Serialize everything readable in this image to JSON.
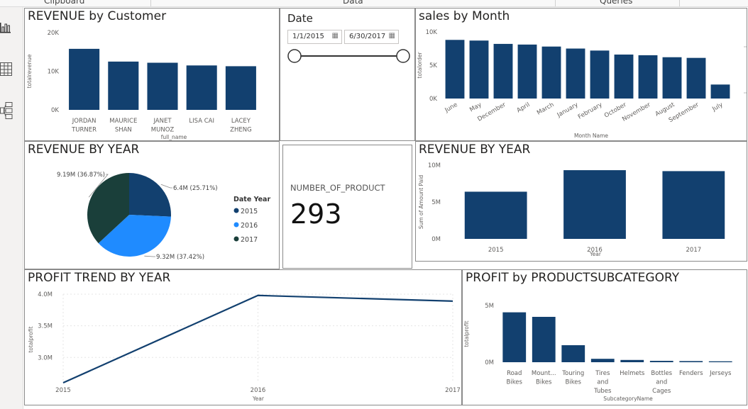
{
  "ribbon": {
    "tabs": [
      "Clipboard",
      "Data",
      "Queries"
    ]
  },
  "rail": {
    "icons": [
      "report-view-icon",
      "data-view-icon",
      "model-view-icon"
    ]
  },
  "colors": {
    "navy": "#12406f",
    "blue": "#1f8bff",
    "dark": "#1a3f3a",
    "grid": "#e5e5e5",
    "axis": "#605e5c"
  },
  "revenue_by_customer": {
    "title": "REVENUE by Customer",
    "chart_data": {
      "type": "bar",
      "categories": [
        [
          "JORDAN",
          "TURNER"
        ],
        [
          "MAURICE",
          "SHAN"
        ],
        [
          "JANET",
          "MUNOZ"
        ],
        [
          "LISA CAI"
        ],
        [
          "LACEY",
          "ZHENG"
        ]
      ],
      "values": [
        15800,
        12500,
        12200,
        11500,
        11300
      ],
      "ylabel": "totalrevenue",
      "xlabel": "full_name",
      "yticks": [
        "20K",
        "10K",
        "0K"
      ],
      "ylim": [
        0,
        20000
      ]
    }
  },
  "date_slicer": {
    "title": "Date",
    "start": "1/1/2015",
    "end": "6/30/2017"
  },
  "sales_by_month": {
    "title": "sales by Month",
    "chart_data": {
      "type": "bar",
      "categories": [
        "June",
        "May",
        "December",
        "April",
        "March",
        "January",
        "February",
        "October",
        "November",
        "August",
        "September",
        "July"
      ],
      "values": [
        8800,
        8700,
        8200,
        8100,
        7800,
        7500,
        7200,
        6600,
        6500,
        6200,
        6100,
        2100
      ],
      "ylabel": "totalorder",
      "xlabel": "Month Name",
      "yticks": [
        "10K",
        "5K",
        "0K"
      ],
      "ylim": [
        0,
        10000
      ]
    }
  },
  "revenue_by_year_pie": {
    "title": "REVENUE BY YEAR",
    "legend_title": "Date Year",
    "chart_data": {
      "type": "pie",
      "series": [
        {
          "name": "2015",
          "value": 6.4,
          "label": "6.4M (25.71%)",
          "color": "#12406f"
        },
        {
          "name": "2016",
          "value": 9.32,
          "label": "9.32M (37.42%)",
          "color": "#1f8bff"
        },
        {
          "name": "2017",
          "value": 9.19,
          "label": "9.19M (36.87%)",
          "color": "#1a3f3a"
        }
      ]
    }
  },
  "number_of_product": {
    "label": "NUMBER_OF_PRODUCT",
    "value": "293"
  },
  "revenue_by_year_bar": {
    "title": "REVENUE BY YEAR",
    "chart_data": {
      "type": "bar",
      "categories": [
        "2015",
        "2016",
        "2017"
      ],
      "values": [
        6.4,
        9.32,
        9.19
      ],
      "ylabel": "Sum of Amount Paid",
      "xlabel": "Year",
      "yticks": [
        "10M",
        "5M",
        "0M"
      ],
      "ylim": [
        0,
        10
      ]
    }
  },
  "profit_trend": {
    "title": "PROFIT TREND BY YEAR",
    "chart_data": {
      "type": "line",
      "x": [
        "2015",
        "2016",
        "2017"
      ],
      "values": [
        2.6,
        3.98,
        3.89
      ],
      "ylabel": "totalprofit",
      "xlabel": "Year",
      "yticks": [
        "4.0M",
        "3.5M",
        "3.0M"
      ],
      "ylim": [
        2.6,
        4.0
      ]
    }
  },
  "profit_by_subcategory": {
    "title": "PROFIT by PRODUCTSUBCATEGORY",
    "chart_data": {
      "type": "bar",
      "categories": [
        [
          "Road",
          "Bikes"
        ],
        [
          "Mount...",
          "Bikes"
        ],
        [
          "Touring",
          "Bikes"
        ],
        [
          "Tires",
          "and",
          "Tubes"
        ],
        [
          "Helmets"
        ],
        [
          "Bottles",
          "and",
          "Cages"
        ],
        [
          "Fenders"
        ],
        [
          "Jerseys"
        ]
      ],
      "values": [
        4.4,
        4.0,
        1.5,
        0.3,
        0.2,
        0.12,
        0.1,
        0.08
      ],
      "ylabel": "totalprofit",
      "xlabel": "SubcategoryName",
      "yticks": [
        "5M",
        "0M"
      ],
      "ylim": [
        0,
        5
      ]
    }
  }
}
